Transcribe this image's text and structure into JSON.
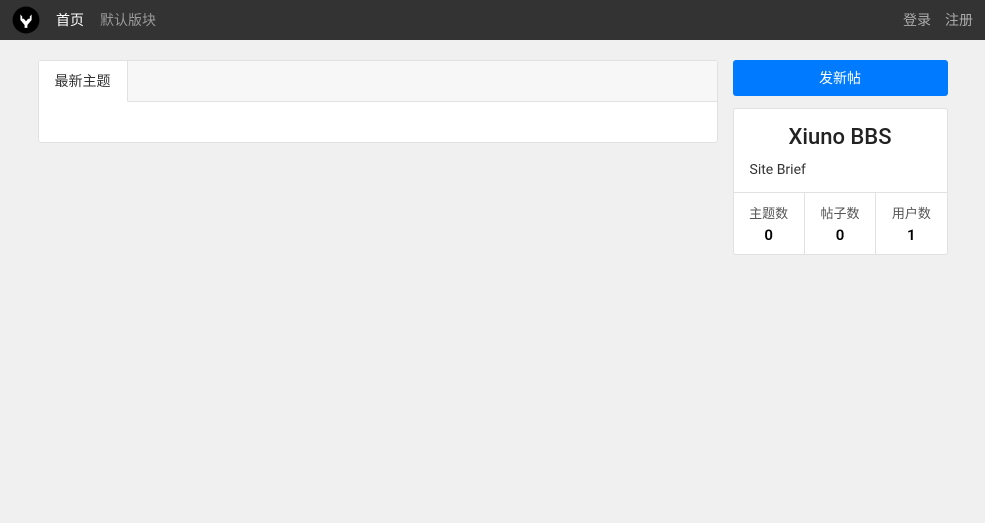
{
  "nav": {
    "home": "首页",
    "default_board": "默认版块",
    "login": "登录",
    "register": "注册"
  },
  "main": {
    "tabs": {
      "latest": "最新主题"
    }
  },
  "sidebar": {
    "new_post_btn": "发新帖",
    "site_title": "Xiuno BBS",
    "site_brief": "Site Brief",
    "stats": {
      "threads_label": "主题数",
      "threads_value": "0",
      "posts_label": "帖子数",
      "posts_value": "0",
      "users_label": "用户数",
      "users_value": "1"
    }
  }
}
